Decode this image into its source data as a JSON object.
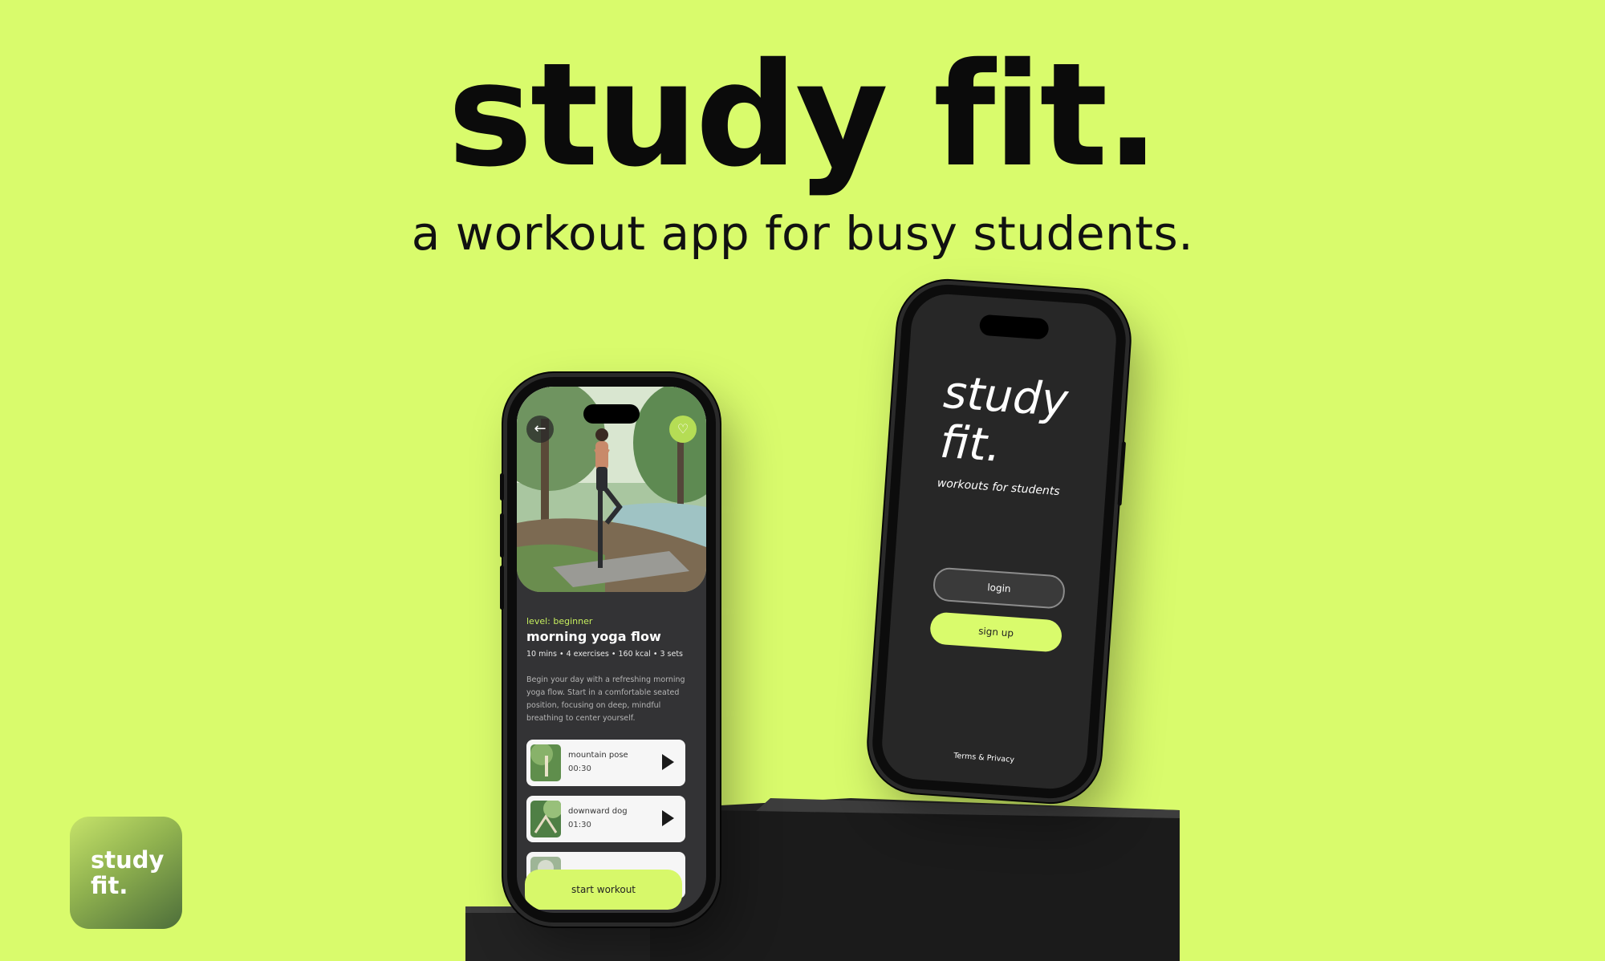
{
  "hero": {
    "title": "study fit.",
    "subtitle": "a workout app for busy students."
  },
  "workout_screen": {
    "back_icon": "arrow-left-icon",
    "favorite_icon": "heart-icon",
    "level": "level: beginner",
    "title": "morning yoga flow",
    "meta": "10 mins • 4 exercises • 160 kcal • 3 sets",
    "description": "Begin your day with a refreshing morning yoga flow. Start in a comfortable seated position, focusing on deep, mindful breathing to center yourself.",
    "exercises": [
      {
        "name": "mountain pose",
        "time": "00:30"
      },
      {
        "name": "downward dog",
        "time": "01:30"
      }
    ],
    "play_icon": "play-icon",
    "start_button": "start workout"
  },
  "login_screen": {
    "app_title_line1": "study",
    "app_title_line2": "fit.",
    "tagline": "workouts for students",
    "login_button": "login",
    "signup_button": "sign up",
    "terms_link": "Terms & Privacy"
  },
  "app_icon": {
    "line1": "study",
    "line2": "fit."
  },
  "colors": {
    "background": "#d9fb6c",
    "accent": "#d9fb6c",
    "phone_screen_dark": "#333335"
  }
}
